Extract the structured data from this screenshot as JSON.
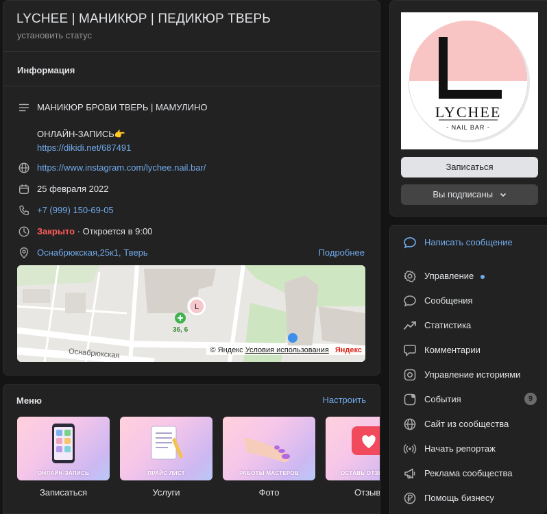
{
  "group": {
    "title": "LYCHEE | МАНИКЮР | ПЕДИКЮР ТВЕРЬ",
    "status": "установить статус"
  },
  "info": {
    "section_title": "Информация",
    "description_line1": "МАНИКЮР БРОВИ ТВЕРЬ | МАМУЛИНО",
    "description_line2": "ОНЛАЙН-ЗАПИСЬ👉",
    "description_link": "https://dikidi.net/687491",
    "website": "https://www.instagram.com/lychee.nail.bar/",
    "date": "25 февраля 2022",
    "phone": "+7 (999) 150-69-05",
    "hours_closed": "Закрыто",
    "hours_rest": " · Откроется в 9:00",
    "address": "Оснабрюкская,25к1, Тверь",
    "more": "Подробнее"
  },
  "map": {
    "house_number": "36, 6",
    "street": "Оснабрюкская",
    "copyright": "© Яндекс",
    "terms": "Условия использования",
    "brand": "Яндекс"
  },
  "menu": {
    "title": "Меню",
    "configure": "Настроить",
    "items": [
      {
        "caption": "ОНЛАЙН-ЗАПИСЬ",
        "label": "Записаться"
      },
      {
        "caption": "ПРАЙС ЛИСТ",
        "label": "Услуги"
      },
      {
        "caption": "РАБОТЫ МАСТЕРОВ",
        "label": "Фото"
      },
      {
        "caption": "ОСТАВЬ ОТЗЫВ",
        "label": "Отзывы"
      }
    ]
  },
  "avatar": {
    "logo_letter": "L",
    "logo_name": "LYCHEE",
    "logo_sub": "- NAIL BAR -"
  },
  "buttons": {
    "join": "Записаться",
    "subscribed": "Вы подписаны"
  },
  "actions": [
    {
      "label": "Написать сообщение",
      "icon": "message-icon"
    },
    {
      "label": "Управление",
      "icon": "gear-icon"
    },
    {
      "label": "Сообщения",
      "icon": "chat-icon"
    },
    {
      "label": "Статистика",
      "icon": "stats-icon"
    },
    {
      "label": "Комментарии",
      "icon": "comment-icon"
    },
    {
      "label": "Управление историями",
      "icon": "stories-icon"
    },
    {
      "label": "События",
      "icon": "events-icon",
      "badge": "9"
    },
    {
      "label": "Сайт из сообщества",
      "icon": "globe-icon"
    },
    {
      "label": "Начать репортаж",
      "icon": "broadcast-icon"
    },
    {
      "label": "Реклама сообщества",
      "icon": "megaphone-icon"
    },
    {
      "label": "Помощь бизнесу",
      "icon": "ruble-icon"
    }
  ],
  "colors": {
    "accent": "#71aaeb",
    "closed": "#ff5c5c",
    "card": "#222222",
    "background": "#141414"
  }
}
